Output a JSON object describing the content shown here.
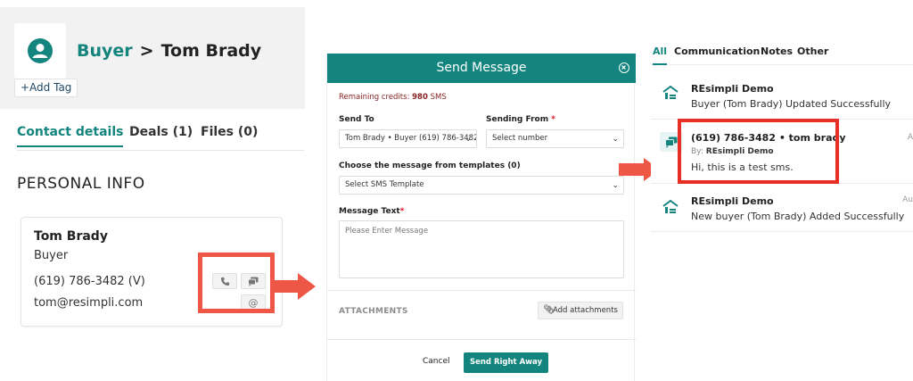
{
  "left": {
    "breadcrumb_link": "Buyer",
    "breadcrumb_sep": ">",
    "breadcrumb_name": "Tom Brady",
    "add_tag": "+Add Tag",
    "tabs": [
      {
        "label": "Contact details"
      },
      {
        "label": "Deals (1)"
      },
      {
        "label": "Files (0)"
      }
    ],
    "section_title": "PERSONAL INFO",
    "card": {
      "name": "Tom Brady",
      "role": "Buyer",
      "phone": "(619) 786-3482 (V)",
      "email": "tom@resimpli.com"
    }
  },
  "modal": {
    "title": "Send Message",
    "credits_prefix": "Remaining credits:",
    "credits_value": "980",
    "credits_unit": "SMS",
    "send_to_label": "Send To",
    "send_to_value": "Tom Brady • Buyer (619) 786-3482",
    "sending_from_label": "Sending From",
    "sending_from_value": "Select number",
    "template_label": "Choose the message from templates (0)",
    "template_value": "Select SMS Template",
    "message_label": "Message Text",
    "message_placeholder": "Please Enter Message",
    "attachments_label": "ATTACHMENTS",
    "add_attachments": "Add attachments",
    "cancel": "Cancel",
    "send": "Send Right Away"
  },
  "right": {
    "tabs": [
      {
        "label": "All"
      },
      {
        "label": "Communication"
      },
      {
        "label": "Notes"
      },
      {
        "label": "Other"
      }
    ],
    "feed": [
      {
        "title": "REsimpli Demo",
        "sub": "Buyer (Tom Brady) Updated Successfully"
      },
      {
        "title": "(619) 786-3482 • tom brady",
        "by_prefix": "By:",
        "by_name": "REsimpli Demo",
        "sub": "Hi, this is a test sms.",
        "date": "A"
      },
      {
        "title": "REsimpli Demo",
        "sub": "New buyer (Tom Brady) Added Successfully",
        "date": "Au"
      }
    ]
  },
  "colors": {
    "brand_teal": "#14857e",
    "highlight_red": "#ee5745"
  }
}
